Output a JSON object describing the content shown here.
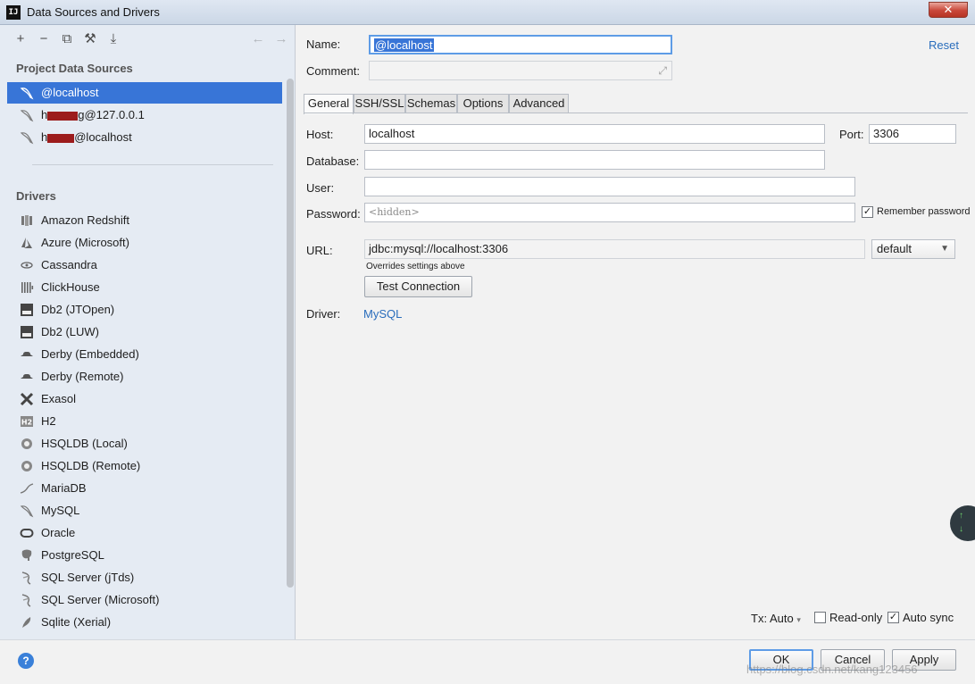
{
  "window": {
    "title": "Data Sources and Drivers",
    "close_glyph": "✕"
  },
  "toolbar": {
    "add": "+",
    "remove": "−",
    "copy": "⧉",
    "settings": "⚒",
    "import": "⤓",
    "back": "←",
    "forward": "→"
  },
  "project_data_sources": {
    "heading": "Project Data Sources",
    "items": [
      {
        "prefix": "",
        "label": "@localhost",
        "selected": true
      },
      {
        "prefix": "h",
        "label": "g@127.0.0.1",
        "selected": false,
        "redacted": true
      },
      {
        "prefix": "h",
        "label": "@localhost",
        "selected": false,
        "redacted": true
      }
    ]
  },
  "drivers": {
    "heading": "Drivers",
    "items": [
      {
        "label": "Amazon Redshift",
        "icon": "redshift-icon"
      },
      {
        "label": "Azure (Microsoft)",
        "icon": "azure-icon"
      },
      {
        "label": "Cassandra",
        "icon": "cassandra-icon"
      },
      {
        "label": "ClickHouse",
        "icon": "clickhouse-icon"
      },
      {
        "label": "Db2 (JTOpen)",
        "icon": "db2-icon"
      },
      {
        "label": "Db2 (LUW)",
        "icon": "db2-icon"
      },
      {
        "label": "Derby (Embedded)",
        "icon": "derby-icon"
      },
      {
        "label": "Derby (Remote)",
        "icon": "derby-icon"
      },
      {
        "label": "Exasol",
        "icon": "exasol-icon"
      },
      {
        "label": "H2",
        "icon": "h2-icon"
      },
      {
        "label": "HSQLDB (Local)",
        "icon": "hsqldb-icon"
      },
      {
        "label": "HSQLDB (Remote)",
        "icon": "hsqldb-icon"
      },
      {
        "label": "MariaDB",
        "icon": "mariadb-icon"
      },
      {
        "label": "MySQL",
        "icon": "mysql-icon"
      },
      {
        "label": "Oracle",
        "icon": "oracle-icon"
      },
      {
        "label": "PostgreSQL",
        "icon": "postgresql-icon"
      },
      {
        "label": "SQL Server (jTds)",
        "icon": "sqlserver-icon"
      },
      {
        "label": "SQL Server (Microsoft)",
        "icon": "sqlserver-icon"
      },
      {
        "label": "Sqlite (Xerial)",
        "icon": "sqlite-icon"
      }
    ]
  },
  "form": {
    "name_label": "Name:",
    "name_value": "@localhost",
    "comment_label": "Comment:",
    "reset_label": "Reset",
    "tabs": [
      "General",
      "SSH/SSL",
      "Schemas",
      "Options",
      "Advanced"
    ],
    "active_tab": "General",
    "host_label": "Host:",
    "host_value": "localhost",
    "port_label": "Port:",
    "port_value": "3306",
    "database_label": "Database:",
    "database_value": "",
    "user_label": "User:",
    "user_value": "",
    "password_label": "Password:",
    "password_placeholder": "<hidden>",
    "remember_password_label": "Remember password",
    "remember_password_checked": true,
    "url_label": "URL:",
    "url_value": "jdbc:mysql://localhost:3306",
    "url_mode": "default",
    "overrides_note": "Overrides settings above",
    "test_connection_label": "Test Connection",
    "driver_label": "Driver:",
    "driver_value": "MySQL"
  },
  "options_bar": {
    "tx_label": "Tx: Auto",
    "read_only_label": "Read-only",
    "read_only_checked": false,
    "auto_sync_label": "Auto sync",
    "auto_sync_checked": true
  },
  "buttons": {
    "ok": "OK",
    "cancel": "Cancel",
    "apply": "Apply",
    "help": "?"
  },
  "watermark": "https://blog.csdn.net/kang123456"
}
